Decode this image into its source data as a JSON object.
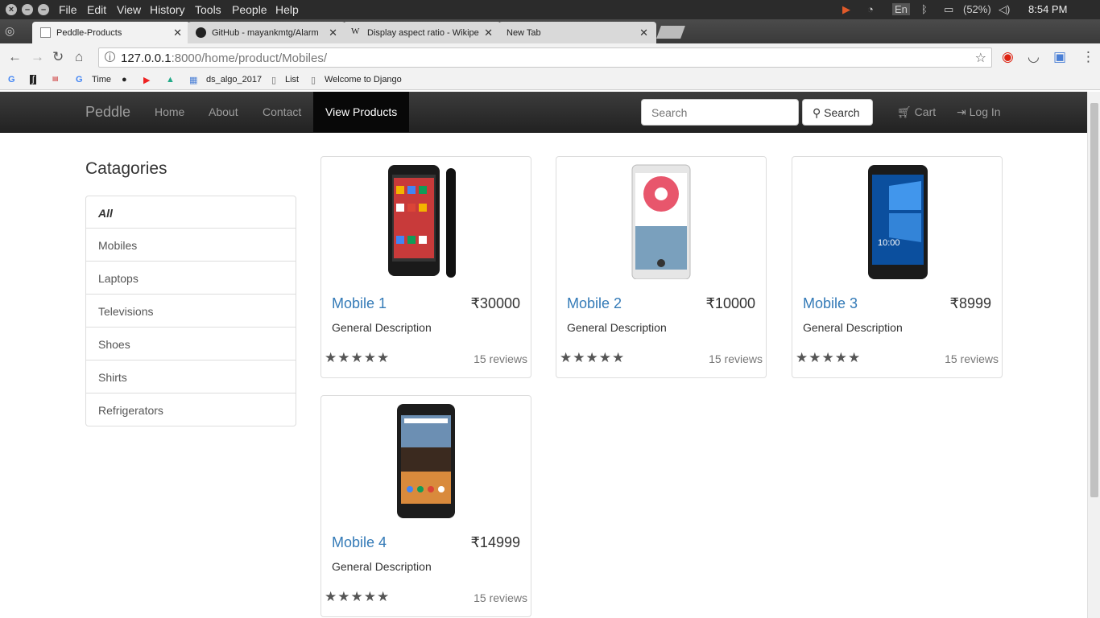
{
  "os": {
    "menu": [
      "File",
      "Edit",
      "View",
      "History",
      "Tools",
      "People",
      "Help"
    ],
    "lang": "En",
    "battery": "(52%)",
    "clock": "8:54 PM"
  },
  "tabs": [
    {
      "title": "Peddle-Products",
      "active": true
    },
    {
      "title": "GitHub - mayankmtg/Alarm",
      "active": false
    },
    {
      "title": "Display aspect ratio - Wikipe",
      "active": false
    },
    {
      "title": "New Tab",
      "active": false
    }
  ],
  "address": {
    "host": "127.0.0.1",
    "rest": ":8000/home/product/Mobiles/"
  },
  "bookmarks": [
    "Time",
    "ds_algo_2017",
    "List",
    "Welcome to Django"
  ],
  "navbar": {
    "brand": "Peddle",
    "links": [
      "Home",
      "About",
      "Contact",
      "View Products"
    ],
    "search_placeholder": "Search",
    "search_button": "Search",
    "cart": "Cart",
    "login": "Log In"
  },
  "categories": {
    "heading": "Catagories",
    "items": [
      "All",
      "Mobiles",
      "Laptops",
      "Televisions",
      "Shoes",
      "Shirts",
      "Refrigerators"
    ],
    "active": "All"
  },
  "products": [
    {
      "name": "Mobile 1",
      "price": "₹30000",
      "description": "General Description",
      "stars": "★★★★★",
      "reviews": "15 reviews"
    },
    {
      "name": "Mobile 2",
      "price": "₹10000",
      "description": "General Description",
      "stars": "★★★★★",
      "reviews": "15 reviews"
    },
    {
      "name": "Mobile 3",
      "price": "₹8999",
      "description": "General Description",
      "stars": "★★★★★",
      "reviews": "15 reviews"
    },
    {
      "name": "Mobile 4",
      "price": "₹14999",
      "description": "General Description",
      "stars": "★★★★★",
      "reviews": "15 reviews"
    }
  ],
  "colors": {
    "link": "#337ab7",
    "navbar": "#222222",
    "muted": "#9d9d9d"
  }
}
